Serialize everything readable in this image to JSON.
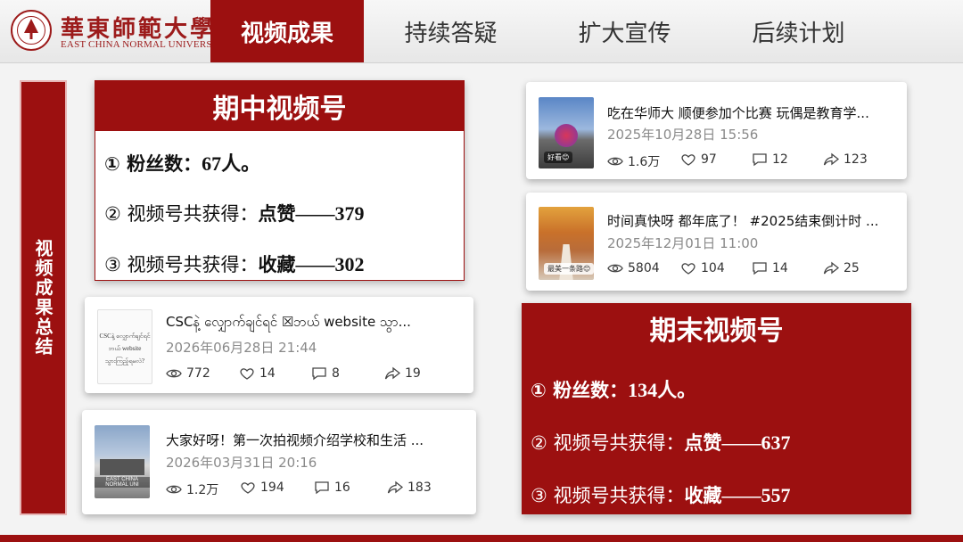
{
  "header": {
    "logo_cn": "華東師範大學",
    "logo_en": "EAST CHINA NORMAL UNIVERSITY",
    "tabs": [
      "视频成果",
      "持续答疑",
      "扩大宣传",
      "后续计划"
    ]
  },
  "side_label": "视频成果总结",
  "midterm": {
    "title": "期中视频号",
    "fans_prefix": "① 粉丝数：",
    "fans_value": "67人。",
    "likes_prefix": "② 视频号共获得：",
    "likes_label": "点赞",
    "likes_value": "——379",
    "fav_prefix": "③ 视频号共获得：",
    "fav_label": "收藏",
    "fav_value": "——302"
  },
  "final": {
    "title": "期末视频号",
    "fans_prefix": "① 粉丝数：",
    "fans_value": "134人。",
    "likes_prefix": "② 视频号共获得：",
    "likes_label": "点赞",
    "likes_value": "——637",
    "fav_prefix": "③ 视频号共获得：",
    "fav_label": "收藏",
    "fav_value": "——557"
  },
  "posts": [
    {
      "title": "CSCနဲ့ လျှောက်ချင်ရင် ☒ဘယ် website သွာ...",
      "date": "2026年06月28日 21:44",
      "views": "772",
      "likes": "14",
      "comments": "8",
      "shares": "19",
      "thumb_text": [
        "CSCနဲ့ လျှောက်ချင်ရင်",
        "ဘယ် website",
        "သွားကြည့်ရမလဲ?"
      ]
    },
    {
      "title": "大家好呀！第一次拍视频介绍学校和生活 ...",
      "date": "2026年03月31日 20:16",
      "views": "1.2万",
      "likes": "194",
      "comments": "16",
      "shares": "183",
      "thumb_text": [
        "EAST CHINA NORMAL UNI"
      ]
    },
    {
      "title": "吃在华师大 顺便参加个比赛 玩偶是教育学...",
      "date": "2025年10月28日 15:56",
      "views": "1.6万",
      "likes": "97",
      "comments": "12",
      "shares": "123",
      "thumb_text": [
        "好看😊"
      ]
    },
    {
      "title": "时间真快呀 都年底了！ #2025结束倒计时 ...",
      "date": "2025年12月01日 11:00",
      "views": "5804",
      "likes": "104",
      "comments": "14",
      "shares": "25",
      "thumb_text": [
        "最美一条路😊"
      ]
    }
  ],
  "colors": {
    "accent": "#9c1010",
    "muted": "#8a8a8a"
  }
}
